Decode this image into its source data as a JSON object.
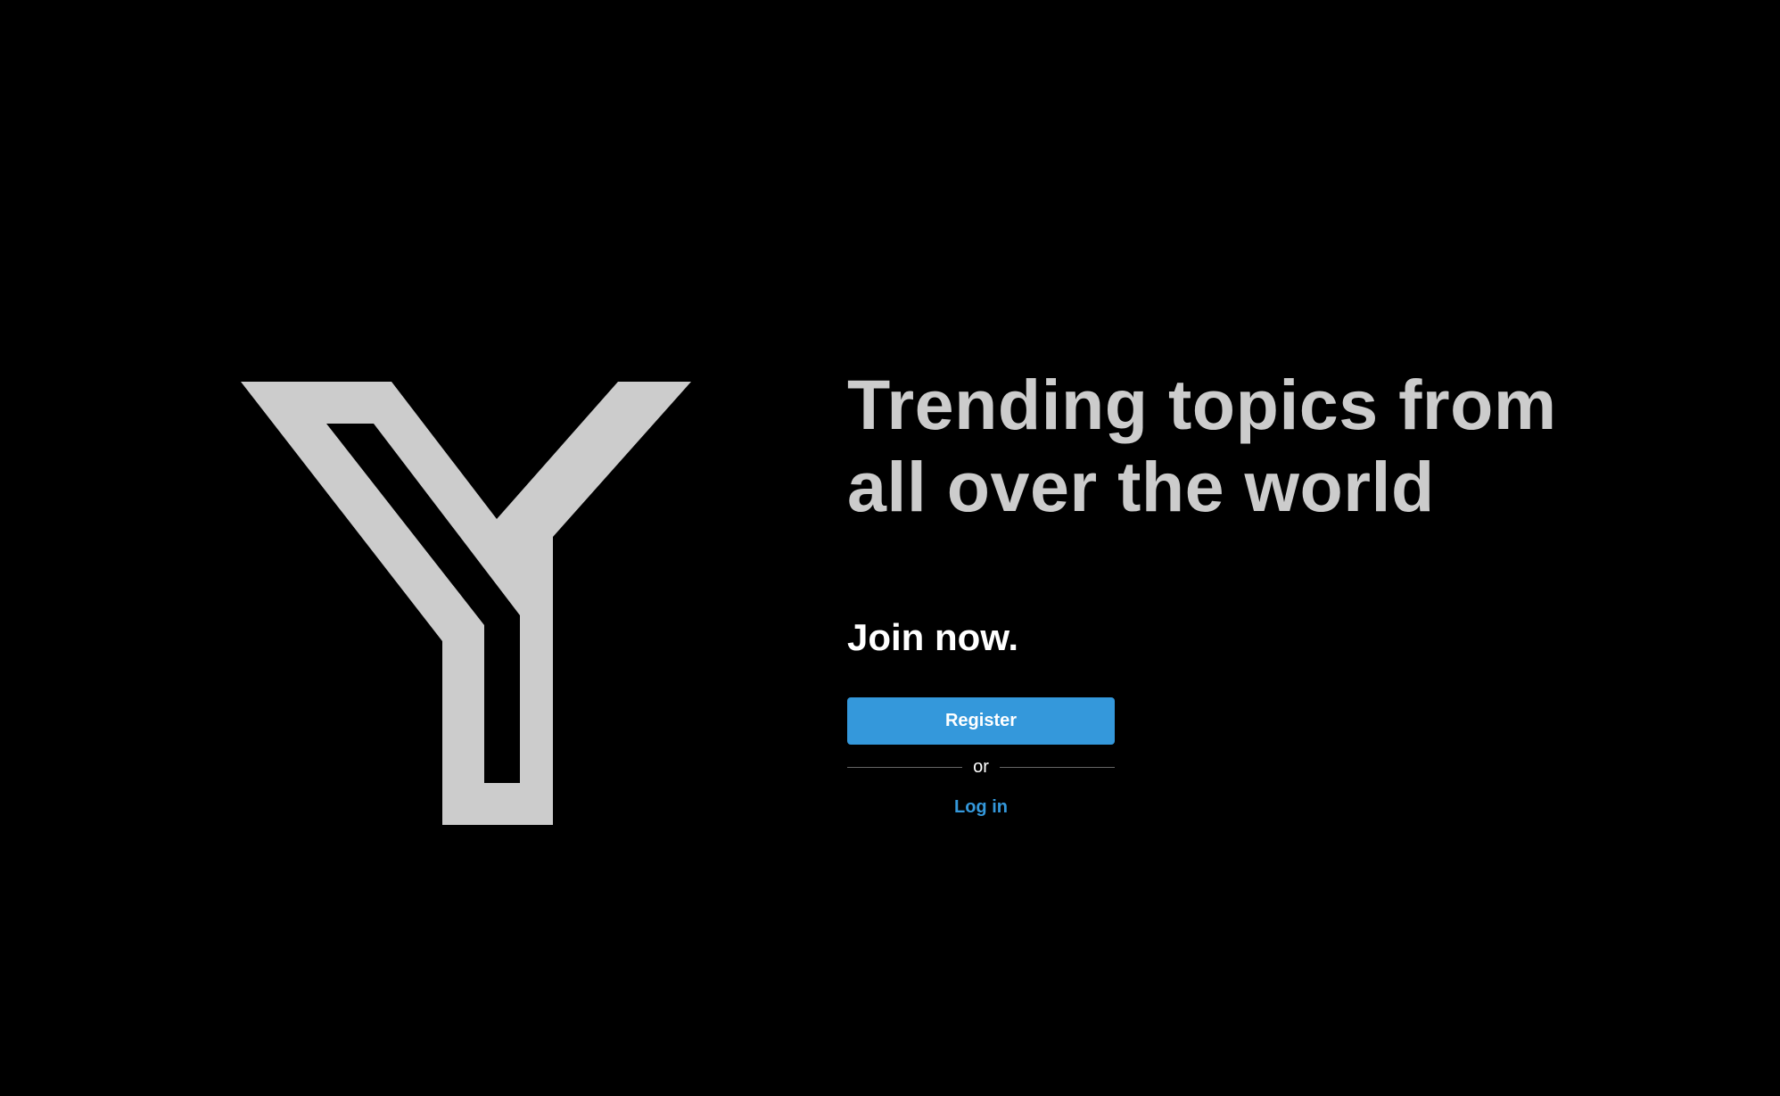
{
  "logo": {
    "icon": "y-logo-icon",
    "color": "#cccccc"
  },
  "hero": {
    "headline_line1": "Trending topics from",
    "headline_line2": "all over the world"
  },
  "signup": {
    "join_text": "Join now.",
    "register_label": "Register",
    "or_text": "or",
    "login_label": "Log in"
  },
  "colors": {
    "background": "#000000",
    "accent": "#3498db",
    "headline": "#cccccc"
  }
}
